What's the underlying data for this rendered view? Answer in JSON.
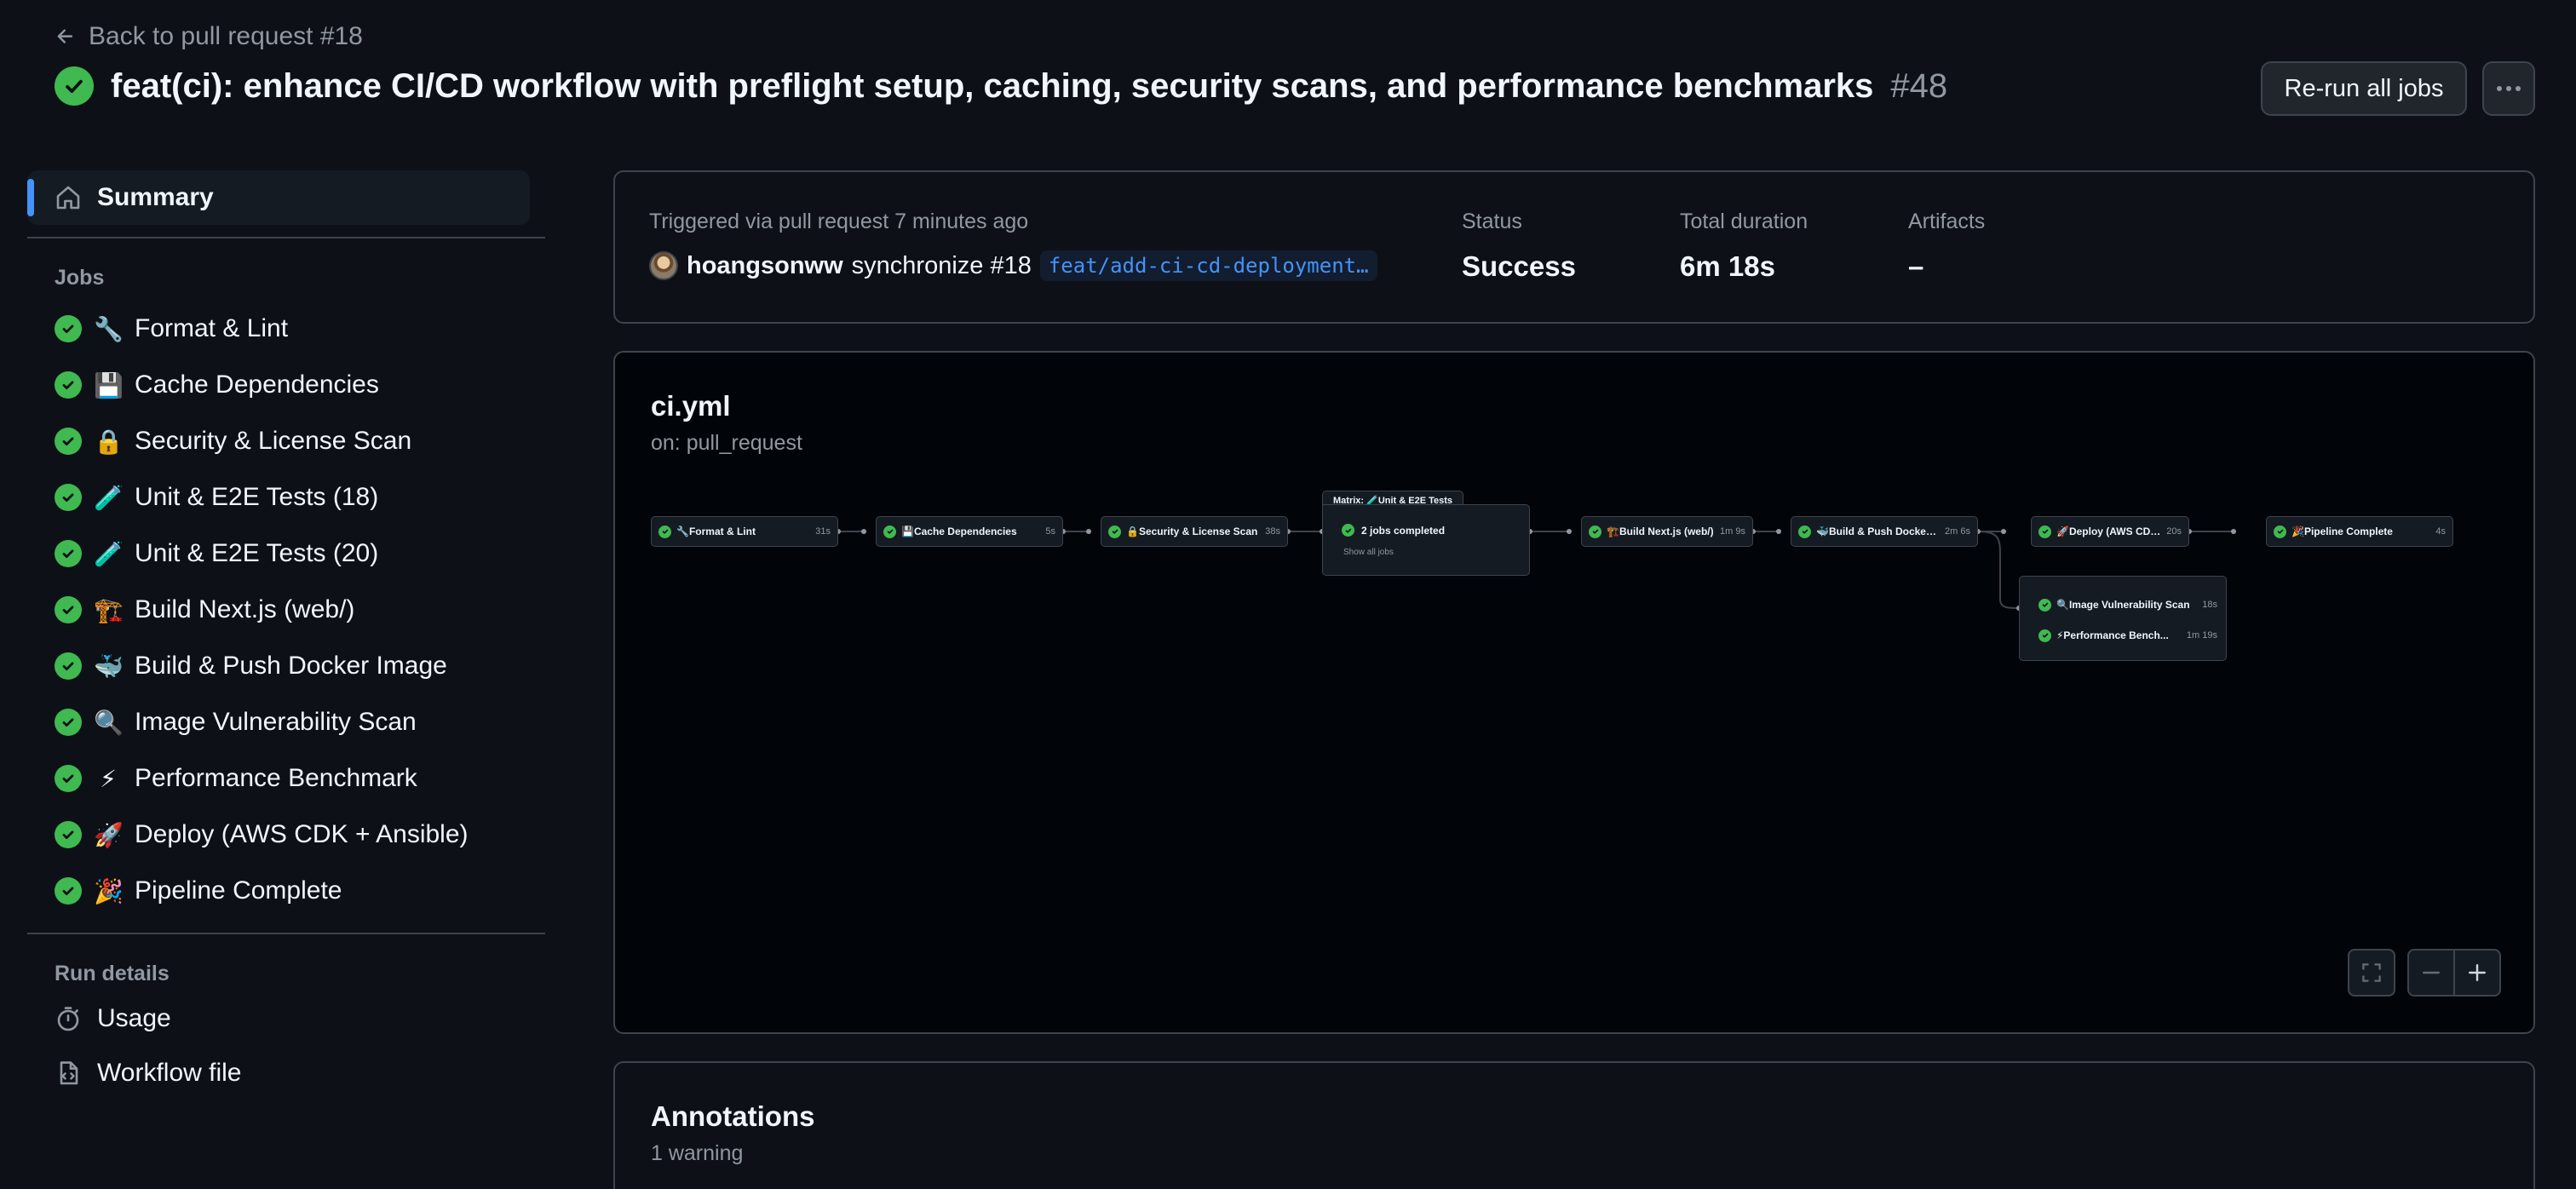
{
  "header": {
    "back_link": "Back to pull request #18",
    "title": "feat(ci): enhance CI/CD workflow with preflight setup, caching, security scans, and performance benchmarks",
    "run_number": "#48",
    "rerun_label": "Re-run all jobs"
  },
  "sidebar": {
    "summary_label": "Summary",
    "jobs_heading": "Jobs",
    "jobs": [
      {
        "emoji": "🔧",
        "label": "Format & Lint"
      },
      {
        "emoji": "💾",
        "label": "Cache Dependencies"
      },
      {
        "emoji": "🔒",
        "label": "Security & License Scan"
      },
      {
        "emoji": "🧪",
        "label": "Unit & E2E Tests (18)"
      },
      {
        "emoji": "🧪",
        "label": "Unit & E2E Tests (20)"
      },
      {
        "emoji": "🏗️",
        "label": "Build Next.js (web/)"
      },
      {
        "emoji": "🐳",
        "label": "Build & Push Docker Image"
      },
      {
        "emoji": "🔍",
        "label": "Image Vulnerability Scan"
      },
      {
        "emoji": "⚡",
        "label": "Performance Benchmark"
      },
      {
        "emoji": "🚀",
        "label": "Deploy (AWS CDK + Ansible)"
      },
      {
        "emoji": "🎉",
        "label": "Pipeline Complete"
      }
    ],
    "run_details_heading": "Run details",
    "usage_label": "Usage",
    "workflow_file_label": "Workflow file"
  },
  "trigger": {
    "triggered_text": "Triggered via pull request 7 minutes ago",
    "actor": "hoangsonww",
    "action": "synchronize #18",
    "branch": "feat/add-ci-cd-deployment…",
    "status_label": "Status",
    "status_value": "Success",
    "duration_label": "Total duration",
    "duration_value": "6m 18s",
    "artifacts_label": "Artifacts",
    "artifacts_value": "–"
  },
  "graph": {
    "workflow_name": "ci.yml",
    "trigger_event": "on: pull_request",
    "nodes": [
      {
        "name": "🔧Format & Lint",
        "time": "31s"
      },
      {
        "name": "💾Cache Dependencies",
        "time": "5s"
      },
      {
        "name": "🔒Security & License Scan",
        "time": "38s"
      },
      {
        "name": "🏗️Build Next.js (web/)",
        "time": "1m 9s"
      },
      {
        "name": "🐳Build & Push Docker I...",
        "time": "2m 6s"
      },
      {
        "name": "🚀Deploy (AWS CDK + An...",
        "time": "20s"
      },
      {
        "name": "🎉Pipeline Complete",
        "time": "4s"
      }
    ],
    "matrix": {
      "title": "Matrix: 🧪Unit & E2E Tests",
      "summary": "2 jobs completed",
      "show_all": "Show all jobs"
    },
    "parallel": [
      {
        "name": "🔍Image Vulnerability Scan",
        "time": "18s"
      },
      {
        "name": "⚡Performance Bench...",
        "time": "1m 19s"
      }
    ]
  },
  "annotations": {
    "title": "Annotations",
    "count": "1 warning"
  },
  "colors": {
    "success": "#3fb950",
    "accent": "#4493f8",
    "background": "#0d1117"
  }
}
